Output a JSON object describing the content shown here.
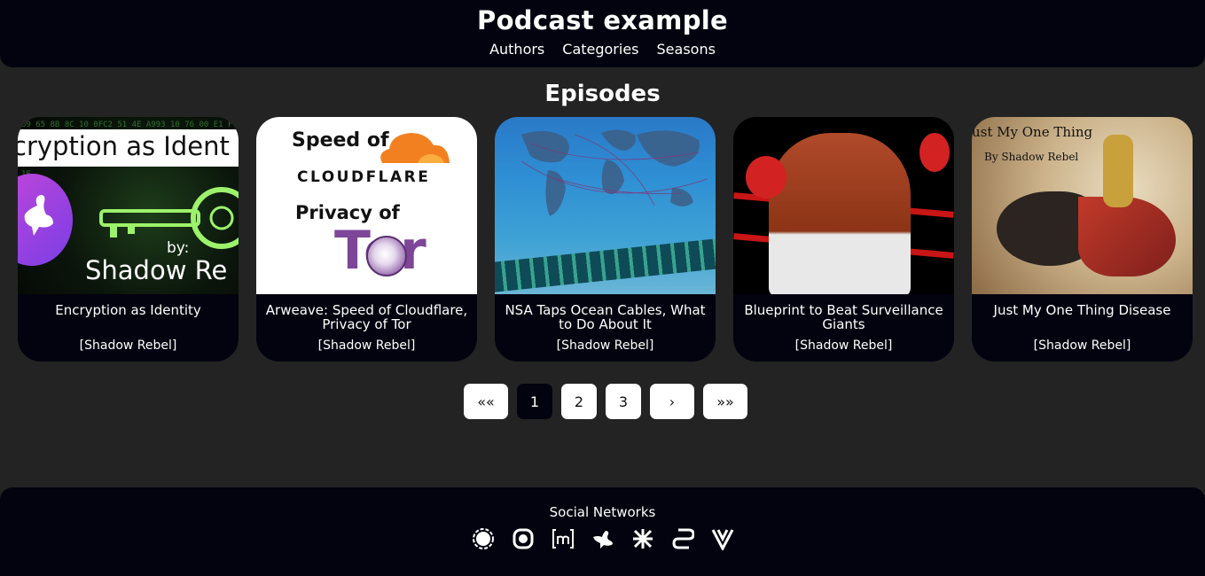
{
  "header": {
    "title": "Podcast example",
    "nav": [
      "Authors",
      "Categories",
      "Seasons"
    ]
  },
  "main": {
    "section_title": "Episodes",
    "episodes": [
      {
        "title": "Encryption as Identity",
        "author": "[Shadow Rebel]",
        "thumb_text": {
          "heading": "cryption as Ident",
          "by": "by:",
          "name": "Shadow Re"
        }
      },
      {
        "title": "Arweave: Speed of Cloudflare, Privacy of Tor",
        "author": "[Shadow Rebel]",
        "thumb_text": {
          "line1": "Speed of",
          "line2": "CLOUDFLARE",
          "line3": "Privacy of",
          "line4": "Tor"
        }
      },
      {
        "title": "NSA Taps Ocean Cables, What to Do About It",
        "author": "[Shadow Rebel]"
      },
      {
        "title": "Blueprint to Beat Surveillance Giants",
        "author": "[Shadow Rebel]"
      },
      {
        "title": "Just My One Thing Disease",
        "author": "[Shadow Rebel]",
        "thumb_text": {
          "line1": "ust My One Thing",
          "line2": "By Shadow Rebel"
        }
      }
    ]
  },
  "pagination": {
    "first": "««",
    "pages": [
      "1",
      "2",
      "3"
    ],
    "current": "1",
    "next": "›",
    "last": "»»"
  },
  "footer": {
    "title": "Social Networks",
    "icons": [
      "signal-icon",
      "element-icon",
      "matrix-icon",
      "nostr-icon",
      "session-icon",
      "simplex-icon",
      "vlog-icon"
    ]
  },
  "colors": {
    "background": "#232323",
    "bar": "#02030f",
    "text": "#ffffff",
    "button": "#ffffff"
  }
}
